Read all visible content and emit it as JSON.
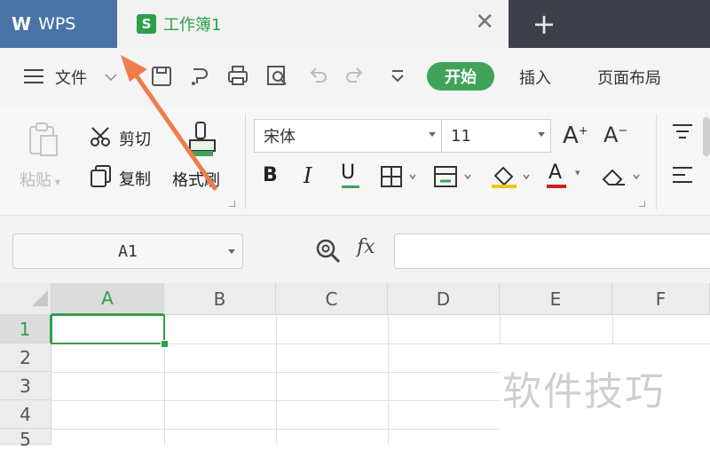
{
  "titlebar": {
    "app_name": "WPS",
    "doc_tab": "工作簿1",
    "sheet_icon_letter": "S",
    "close_glyph": "✕",
    "new_tab_glyph": "+"
  },
  "menubar": {
    "file_label": "文件",
    "tabs": [
      "开始",
      "插入",
      "页面布局"
    ],
    "active_tab_color": "#3fa35a"
  },
  "ribbon": {
    "paste": "粘贴",
    "cut": "剪切",
    "copy": "复制",
    "format_painter": "格式刷",
    "font_name": "宋体",
    "font_size": "11",
    "bold": "B",
    "italic": "I",
    "underline": "U",
    "font_color_label": "A",
    "font_color": "#c9211e"
  },
  "formula": {
    "name_box": "A1",
    "fx": "fx"
  },
  "grid": {
    "columns": [
      "A",
      "B",
      "C",
      "D",
      "E",
      "F"
    ],
    "rows": [
      "1",
      "2",
      "3",
      "4",
      "5"
    ],
    "selected_cell": "A1",
    "accent": "#2e9f49"
  },
  "watermark": "软件技巧"
}
